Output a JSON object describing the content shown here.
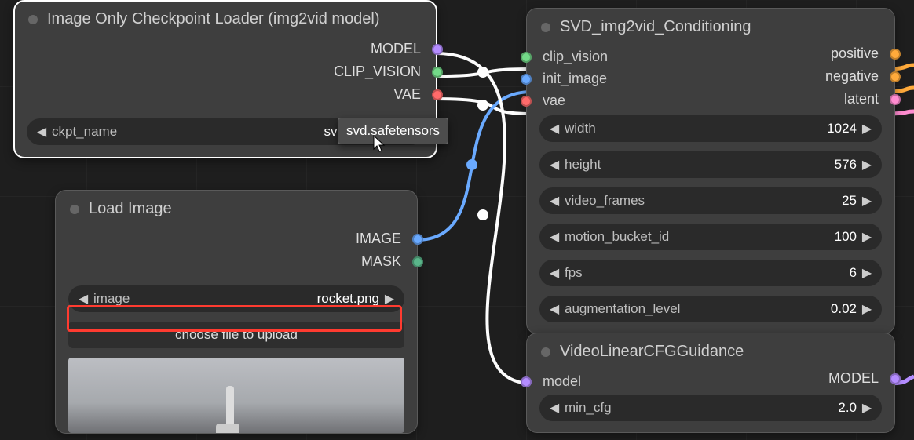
{
  "nodes": {
    "ckptLoader": {
      "title": "Image Only Checkpoint Loader (img2vid model)",
      "outputs": {
        "model": "MODEL",
        "clip_vision": "CLIP_VISION",
        "vae": "VAE"
      },
      "widgets": {
        "ckpt_name": {
          "label": "ckpt_name",
          "value": "svd.safetens"
        }
      },
      "tooltip": "svd.safetensors"
    },
    "loadImage": {
      "title": "Load Image",
      "outputs": {
        "image": "IMAGE",
        "mask": "MASK"
      },
      "widgets": {
        "image": {
          "label": "image",
          "value": "rocket.png"
        },
        "upload": {
          "label": "choose file to upload"
        }
      }
    },
    "svdCond": {
      "title": "SVD_img2vid_Conditioning",
      "inputs": {
        "clip_vision": "clip_vision",
        "init_image": "init_image",
        "vae": "vae"
      },
      "outputs": {
        "positive": "positive",
        "negative": "negative",
        "latent": "latent"
      },
      "widgets": {
        "width": {
          "label": "width",
          "value": "1024"
        },
        "height": {
          "label": "height",
          "value": "576"
        },
        "video_frames": {
          "label": "video_frames",
          "value": "25"
        },
        "motion_bucket_id": {
          "label": "motion_bucket_id",
          "value": "100"
        },
        "fps": {
          "label": "fps",
          "value": "6"
        },
        "augmentation_level": {
          "label": "augmentation_level",
          "value": "0.02"
        }
      }
    },
    "vlcfg": {
      "title": "VideoLinearCFGGuidance",
      "inputs": {
        "model": "model"
      },
      "outputs": {
        "model": "MODEL"
      },
      "widgets": {
        "min_cfg": {
          "label": "min_cfg",
          "value": "2.0"
        }
      }
    }
  },
  "colors": {
    "model": "#b48cff",
    "clip": "#73d988",
    "vae": "#ff6b6b",
    "image": "#6aaaff",
    "mask": "#5ab58a",
    "cond": "#ffaa3b",
    "latent": "#ff8cd0"
  }
}
